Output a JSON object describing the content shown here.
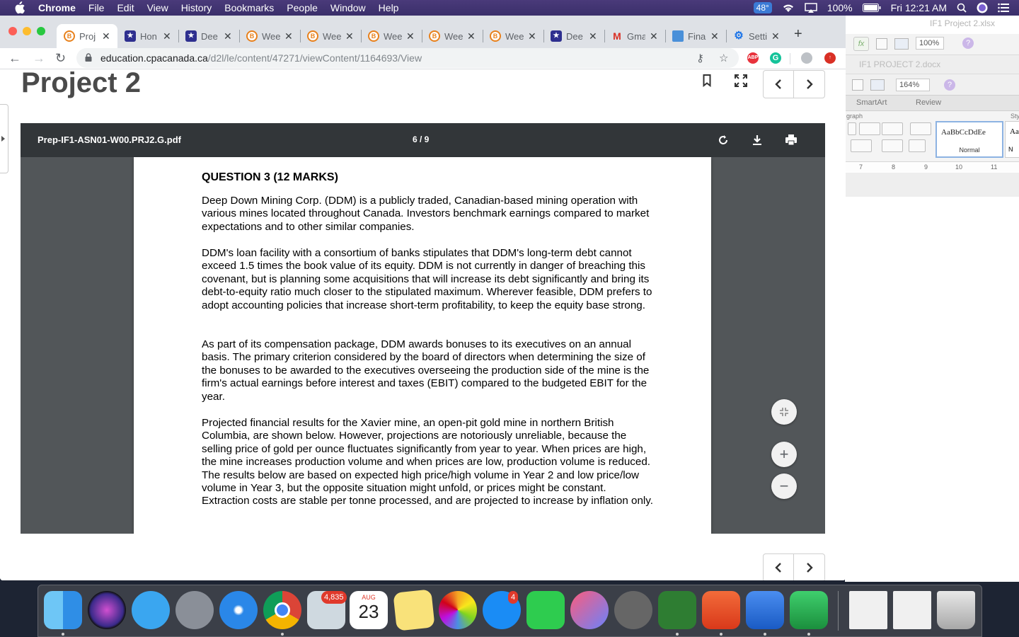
{
  "menubar": {
    "app": "Chrome",
    "items": [
      "File",
      "Edit",
      "View",
      "History",
      "Bookmarks",
      "People",
      "Window",
      "Help"
    ],
    "weather": "48°",
    "battery": "100%",
    "clock": "Fri 12:21 AM"
  },
  "office": {
    "excel_title": "IF1 Project 2.xlsx",
    "excel_fx": "fx",
    "excel_zoom": "100%",
    "word_title": "IF1 PROJECT 2.docx",
    "word_zoom": "164%",
    "tabs": [
      "SmartArt",
      "Review"
    ],
    "paragraph_label": "graph",
    "styles_label": "Sty",
    "style_sample": "AaBbCcDdEe",
    "style_name": "Normal",
    "style_sample2": "Aa",
    "style_name2": "N",
    "ruler": [
      "7",
      "8",
      "9",
      "10",
      "11"
    ]
  },
  "tabs": [
    {
      "icon": "B",
      "label": "Proj",
      "active": true
    },
    {
      "icon": "★",
      "label": "Hon"
    },
    {
      "icon": "★",
      "label": "Dee"
    },
    {
      "icon": "B",
      "label": "Wee"
    },
    {
      "icon": "B",
      "label": "Wee"
    },
    {
      "icon": "B",
      "label": "Wee"
    },
    {
      "icon": "B",
      "label": "Wee"
    },
    {
      "icon": "B",
      "label": "Wee"
    },
    {
      "icon": "★",
      "label": "Dee"
    },
    {
      "icon": "M",
      "label": "Gma"
    },
    {
      "icon": "",
      "label": "Fina"
    },
    {
      "icon": "⚙",
      "label": "Setti"
    }
  ],
  "address": {
    "domain": "education.cpacanada.ca",
    "path": "/d2l/le/content/47271/viewContent/1164693/View",
    "ext_abp": "ABP"
  },
  "page": {
    "title": "Project 2"
  },
  "pdf": {
    "filename": "Prep-IF1-ASN01-W00.PRJ2.G.pdf",
    "page_indicator": "6 / 9",
    "heading": "QUESTION 3 (12 MARKS)",
    "paragraphs": [
      "Deep Down Mining Corp. (DDM) is a publicly traded, Canadian-based mining operation with various mines located throughout Canada. Investors benchmark earnings compared to market expectations and to other similar companies.",
      "DDM's loan facility with a consortium of banks stipulates that DDM's long-term debt cannot exceed 1.5 times the book value of its equity. DDM is not currently in danger of breaching this covenant, but is planning some acquisitions that will increase its debt significantly and bring its debt-to-equity ratio much closer to the stipulated maximum. Wherever feasible, DDM prefers to adopt accounting policies that increase short-term profitability, to keep the equity base strong.",
      "As part of its compensation package, DDM awards bonuses to its executives on an annual basis. The primary criterion considered by the board of directors when determining the size of the bonuses to be awarded to the executives overseeing the production side of the mine is the firm's actual earnings before interest and taxes (EBIT) compared to the budgeted EBIT for the year.",
      "Projected financial results for the Xavier mine, an open-pit gold mine in northern British Columbia, are shown below. However, projections are notoriously unreliable, because the selling price of gold per ounce fluctuates significantly from year to year. When prices are high, the mine increases production volume and when prices are low, production volume is reduced. The results below are based on expected high price/high volume in Year 2 and low price/low volume in Year 3, but the opposite situation might unfold, or prices might be constant. Extraction costs are stable per tonne processed, and are projected to increase by inflation only."
    ],
    "zoom_in": "+",
    "zoom_out": "−"
  },
  "dock": {
    "mail_badge": "4,835",
    "appstore_badge": "4",
    "calendar_month": "AUG",
    "calendar_day": "23"
  }
}
